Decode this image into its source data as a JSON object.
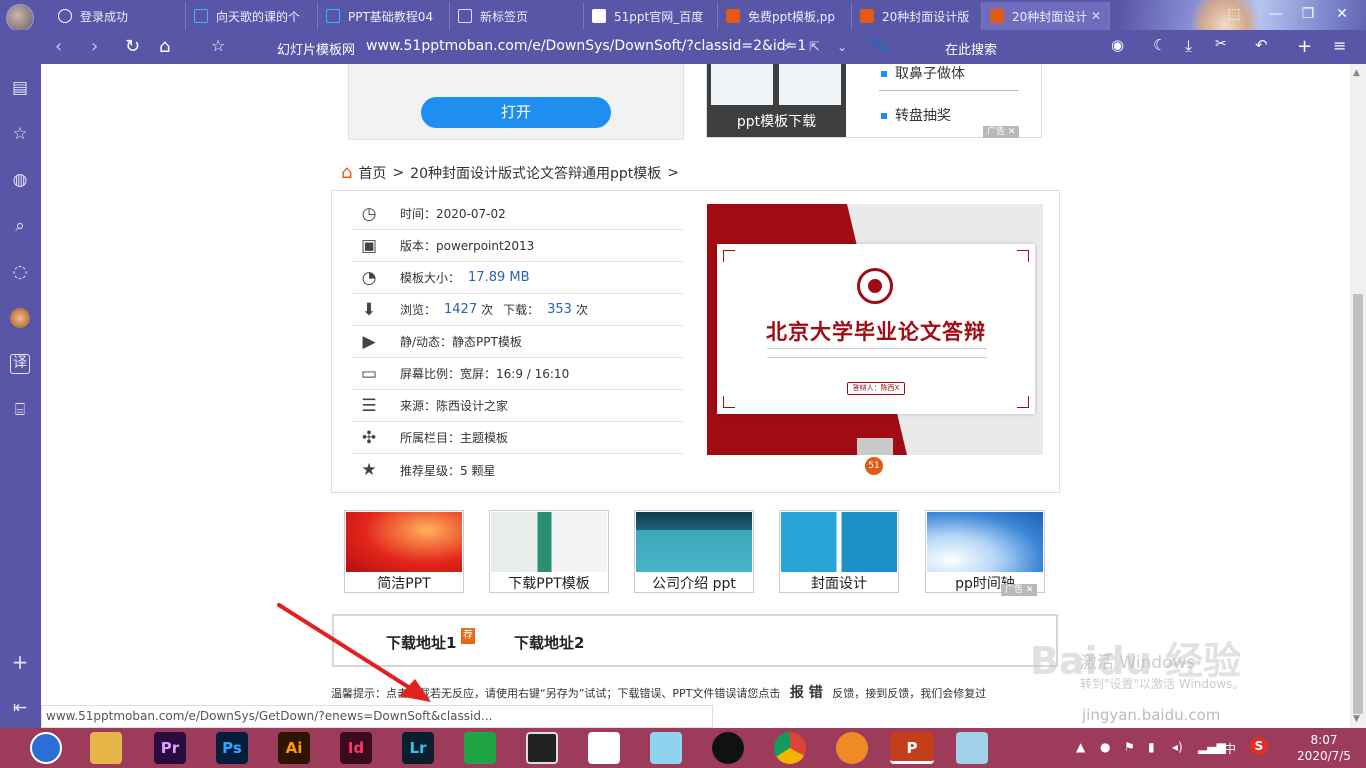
{
  "tabs": [
    {
      "title": "登录成功",
      "icon": "globe-icon"
    },
    {
      "title": "向天歌的课的个",
      "icon": "video-icon"
    },
    {
      "title": "PPT基础教程04",
      "icon": "video-icon"
    },
    {
      "title": "新标签页",
      "icon": "grid-icon"
    },
    {
      "title": "51ppt官网_百度",
      "icon": "baidu-paw-icon"
    },
    {
      "title": "免费ppt模板,pp",
      "icon": "51-icon"
    },
    {
      "title": "20种封面设计版",
      "icon": "51-icon"
    },
    {
      "title": "20种封面设计",
      "icon": "51-icon",
      "active": true
    }
  ],
  "address": {
    "site_name": "幻灯片模板网",
    "url": "www.51pptmoban.com/e/DownSys/DownSoft/?classid=2&id=10(",
    "search_label": "在此搜索"
  },
  "open_button": "打开",
  "ad1": {
    "thumb_caption": "ppt模板下载",
    "items": [
      "取鼻子做体",
      "转盘抽奖"
    ],
    "ad_label": "广告"
  },
  "breadcrumb": {
    "home": "首页",
    "sep1": ">",
    "title": "20种封面设计版式论文答辩通用ppt模板",
    "sep2": ">"
  },
  "info": {
    "time_label": "时间：2020-07-02",
    "version_label": "版本：powerpoint2013",
    "size_label": "模板大小：",
    "size_value": "17.89 MB",
    "views_label": "浏览：",
    "views_value": "1427",
    "times1": "次",
    "downloads_label": "下载：",
    "downloads_value": "353",
    "times2": "次",
    "type_label": "静/动态：静态PPT模板",
    "ratio_label": "屏幕比例：宽屏：16:9 / 16:10",
    "source_label": "来源：陈西设计之家",
    "column_label": "所属栏目：主题模板",
    "rating_label": "推荐星级：5 颗星"
  },
  "preview": {
    "slide_title": "北京大学毕业论文答辩",
    "slide_button": "答辩人：陈西X",
    "logo": "51"
  },
  "categories": [
    {
      "label": "简洁PPT"
    },
    {
      "label": "下载PPT模板"
    },
    {
      "label": "公司介绍 ppt"
    },
    {
      "label": "封面设计"
    },
    {
      "label": "pp时间轴"
    }
  ],
  "ad2_label": "广告",
  "download": {
    "link1": "下载地址1",
    "badge": "荐",
    "link2": "下载地址2"
  },
  "tip": {
    "prefix": "温馨提示：点击下载若无反应，请使用右键“另存为”试试；下载错误、PPT文件错误请您点击",
    "report": "报 错",
    "suffix": "反馈，接到反馈，我们会修复过"
  },
  "status_url": "www.51pptmoban.com/e/DownSys/GetDown/?enews=DownSoft&classid...",
  "watermark": {
    "activate": "激活 Windows",
    "activate_sub": "转到\"设置\"以激活 Windows。",
    "brand": "Baidu 经验",
    "site": "jingyan.baidu.com"
  },
  "taskbar": {
    "apps": [
      {
        "name": "browser",
        "label": "",
        "color": "#2b6fd6"
      },
      {
        "name": "file-explorer",
        "label": "",
        "color": "#e7b64a"
      },
      {
        "name": "premiere",
        "label": "Pr",
        "color": "#2a0b3d"
      },
      {
        "name": "photoshop",
        "label": "Ps",
        "color": "#061e3a"
      },
      {
        "name": "illustrator",
        "label": "Ai",
        "color": "#2d1600"
      },
      {
        "name": "indesign",
        "label": "Id",
        "color": "#3a0a1f"
      },
      {
        "name": "lightroom",
        "label": "Lr",
        "color": "#0b1e2d"
      },
      {
        "name": "green-app",
        "label": "",
        "color": "#21a446"
      },
      {
        "name": "video-editor",
        "label": "",
        "color": "#222222"
      },
      {
        "name": "pie-app",
        "label": "",
        "color": "#ffffff"
      },
      {
        "name": "bird-app",
        "label": "",
        "color": "#8fd3f0"
      },
      {
        "name": "qq",
        "label": "",
        "color": "#111111"
      },
      {
        "name": "chrome",
        "label": "",
        "color": "#e8e8e8"
      },
      {
        "name": "fox-app",
        "label": "",
        "color": "#f08a24"
      },
      {
        "name": "powerpoint",
        "label": "P",
        "color": "#c43e1c"
      },
      {
        "name": "notes-app",
        "label": "",
        "color": "#9fd2e8"
      }
    ],
    "ime": "中",
    "time": "8:07",
    "date": "2020/7/5"
  }
}
